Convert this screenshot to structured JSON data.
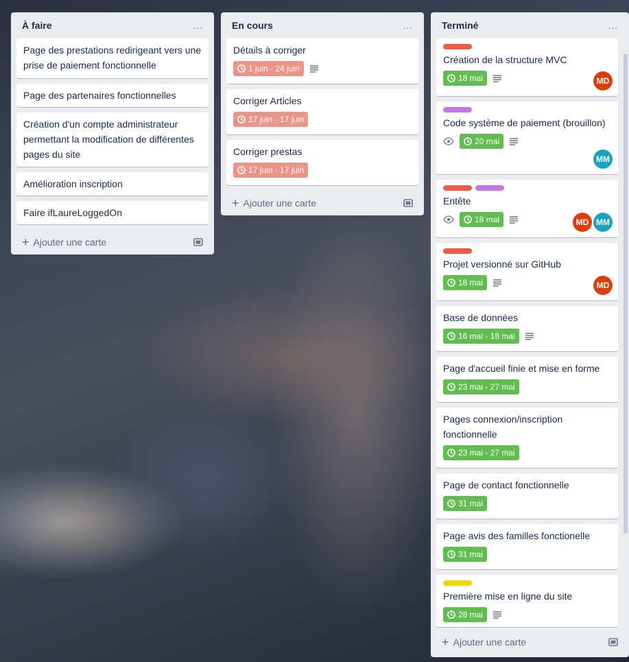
{
  "colors": {
    "label_red": "#eb5a46",
    "label_purple": "#c377e0",
    "label_yellow": "#f2d600",
    "date_green": "#61bd4f",
    "date_red": "#ec9488",
    "avatar_md": "#d93f0b",
    "avatar_mm": "#1ba2bf"
  },
  "icons": [
    "clock-icon",
    "description-icon",
    "eye-icon",
    "template-icon",
    "plus-icon"
  ],
  "add_card_label": "Ajouter une carte",
  "lists": [
    {
      "title": "À faire",
      "menu": "...",
      "cards": [
        {
          "title": "Page des prestations redirigeant vers une prise de paiement fonctionnelle"
        },
        {
          "title": "Page des partenaires fonctionnelles"
        },
        {
          "title": "Création d'un compte administrateur permettant la modification de différentes pages du site"
        },
        {
          "title": "Amélioration inscription"
        },
        {
          "title": "Faire ifLaureLoggedOn"
        }
      ]
    },
    {
      "title": "En cours",
      "menu": "...",
      "cards": [
        {
          "title": "Détails à corriger",
          "date": "1 juin - 24 juin",
          "description": true
        },
        {
          "title": "Corriger Articles",
          "date": "17 juin - 17 juin"
        },
        {
          "title": "Corriger prestas",
          "date": "17 juin - 17 juin"
        }
      ]
    },
    {
      "title": "Terminé",
      "menu": "...",
      "cards": [
        {
          "title": "Création de la structure MVC",
          "date": "18 mai",
          "avatars": [
            "MD"
          ]
        },
        {
          "title": "Code système de paiement (brouillon)",
          "date": "20 mai",
          "avatars": [
            "MM"
          ]
        },
        {
          "title": "Entête",
          "date": "18 mai",
          "avatars": [
            "MD",
            "MM"
          ]
        },
        {
          "title": "Projet versionné sur GitHub",
          "date": "18 mai",
          "avatars": [
            "MD"
          ]
        },
        {
          "title": "Base de données",
          "date": "16 mai - 18 mai"
        },
        {
          "title": "Page d'accueil finie et mise en forme",
          "date": "23 mai - 27 mai"
        },
        {
          "title": "Pages connexion/inscription fonctionnelle",
          "date": "23 mai - 27 mai"
        },
        {
          "title": "Page de contact fonctionnelle",
          "date": "31 mai"
        },
        {
          "title": "Page avis des familles fonctionelle",
          "date": "31 mai"
        },
        {
          "title": "Première mise en ligne du site",
          "date": "28 mai"
        }
      ]
    }
  ]
}
